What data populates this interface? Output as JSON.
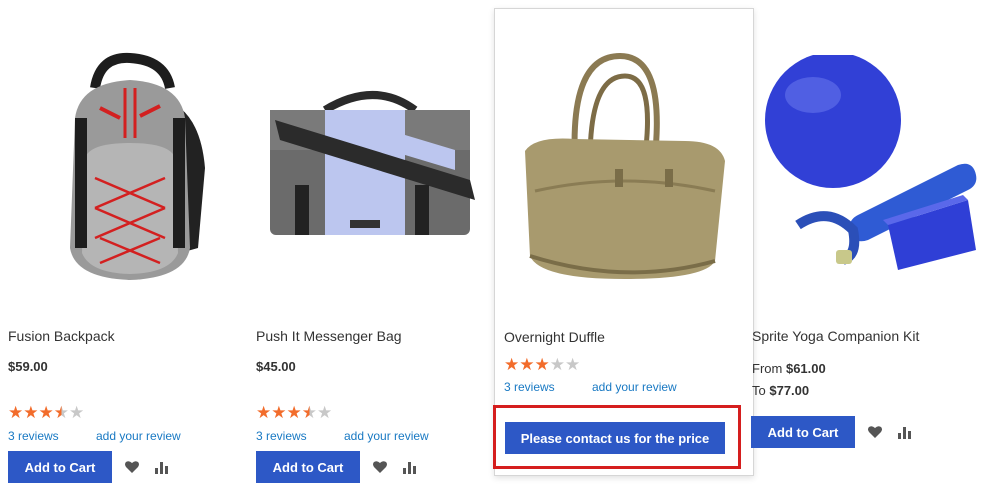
{
  "products": [
    {
      "name": "Fusion Backpack",
      "price": "$59.00",
      "rating": 3.5,
      "reviews_label": "3  reviews",
      "add_review_label": "add your review",
      "button_label": "Add to Cart"
    },
    {
      "name": "Push It Messenger Bag",
      "price": "$45.00",
      "rating": 3.5,
      "reviews_label": "3  reviews",
      "add_review_label": "add your review",
      "button_label": "Add to Cart"
    },
    {
      "name": "Overnight Duffle",
      "rating": 3,
      "reviews_label": "3  reviews",
      "add_review_label": "add your review",
      "button_label": "Please contact us for the price"
    },
    {
      "name": "Sprite Yoga Companion Kit",
      "price_from_label": "From",
      "price_from": "$61.00",
      "price_to_label": "To",
      "price_to": "$77.00",
      "button_label": "Add to Cart"
    }
  ],
  "icons": {
    "wishlist": "heart-icon",
    "compare": "bar-chart-icon"
  },
  "colors": {
    "button": "#2d58c6",
    "star": "#f26c2b",
    "link": "#1979c3",
    "highlight": "#d51e1e"
  }
}
